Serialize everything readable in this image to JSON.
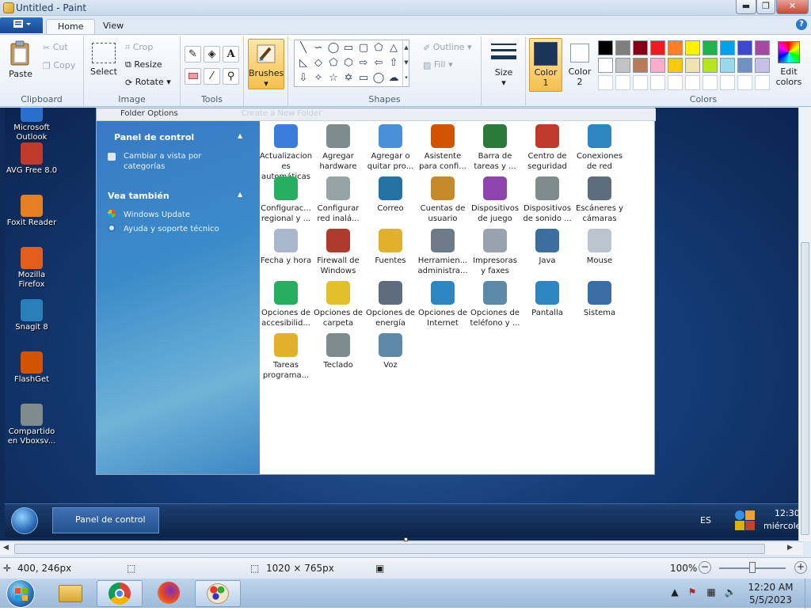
{
  "window": {
    "title": "Untitled - Paint"
  },
  "controls": {
    "minimize": "▬",
    "maximize": "❐",
    "close": "✕"
  },
  "tabs": {
    "home": "Home",
    "view": "View",
    "help": "?"
  },
  "ribbon": {
    "clipboard": {
      "label": "Clipboard",
      "paste": "Paste",
      "cut": "Cut",
      "copy": "Copy"
    },
    "image": {
      "label": "Image",
      "select": "Select",
      "crop": "Crop",
      "resize": "Resize",
      "rotate": "Rotate"
    },
    "tools": {
      "label": "Tools",
      "text_tool": "A"
    },
    "brushes": "Brushes",
    "shapes": {
      "label": "Shapes",
      "outline": "Outline",
      "fill": "Fill"
    },
    "size": "Size",
    "color1": {
      "l1": "Color",
      "l2": "1",
      "value": "#1b3559"
    },
    "color2": {
      "l1": "Color",
      "l2": "2",
      "value": "#ffffff"
    },
    "colors": {
      "label": "Colors",
      "edit_l1": "Edit",
      "edit_l2": "colors",
      "row1": [
        "#000000",
        "#7f7f7f",
        "#880015",
        "#ed1c24",
        "#ff7f27",
        "#fff200",
        "#22b14c",
        "#00a2e8",
        "#3f48cc",
        "#a349a4"
      ],
      "row2": [
        "#ffffff",
        "#c3c3c3",
        "#b97a57",
        "#ffaec9",
        "#ffc90e",
        "#efe4b0",
        "#b5e61d",
        "#99d9ea",
        "#7092be",
        "#c8bfe7"
      ]
    }
  },
  "desktop": {
    "icons": [
      {
        "l1": "Microsoft",
        "l2": "Outlook"
      },
      {
        "l1": "AVG Free 8.0",
        "l2": ""
      },
      {
        "l1": "Foxit Reader",
        "l2": ""
      },
      {
        "l1": "Mozilla",
        "l2": "Firefox"
      },
      {
        "l1": "Snagit 8",
        "l2": ""
      },
      {
        "l1": "FlashGet",
        "l2": ""
      },
      {
        "l1": "Compartido",
        "l2": "en Vboxsv..."
      }
    ],
    "window": {
      "topbar": "Folder Options",
      "topbar_ghost": "Create a New Folder",
      "side": {
        "h1": "Panel de control",
        "link1a": "Cambiar a vista por",
        "link1b": "categorías",
        "h2": "Vea también",
        "link2": "Windows Update",
        "link3": "Ayuda y soporte técnico"
      },
      "items": [
        {
          "l1": "Actualizacion",
          "l2": "es",
          "l3": "automáticas"
        },
        {
          "l1": "Agregar",
          "l2": "hardware",
          "l3": ""
        },
        {
          "l1": "Agregar o",
          "l2": "quitar pro...",
          "l3": ""
        },
        {
          "l1": "Asistente",
          "l2": "para confi...",
          "l3": ""
        },
        {
          "l1": "Barra de",
          "l2": "tareas y ...",
          "l3": ""
        },
        {
          "l1": "Centro de",
          "l2": "seguridad",
          "l3": ""
        },
        {
          "l1": "Conexiones",
          "l2": "de red",
          "l3": ""
        },
        {
          "l1": "Configurac...",
          "l2": "regional y ...",
          "l3": ""
        },
        {
          "l1": "Configurar",
          "l2": "red inalá...",
          "l3": ""
        },
        {
          "l1": "Correo",
          "l2": "",
          "l3": ""
        },
        {
          "l1": "Cuentas de",
          "l2": "usuario",
          "l3": ""
        },
        {
          "l1": "Dispositivos",
          "l2": "de juego",
          "l3": ""
        },
        {
          "l1": "Dispositivos",
          "l2": "de sonido ...",
          "l3": ""
        },
        {
          "l1": "Escáneres y",
          "l2": "cámaras",
          "l3": ""
        },
        {
          "l1": "Fecha y hora",
          "l2": "",
          "l3": ""
        },
        {
          "l1": "Firewall de",
          "l2": "Windows",
          "l3": ""
        },
        {
          "l1": "Fuentes",
          "l2": "",
          "l3": ""
        },
        {
          "l1": "Herramien...",
          "l2": "administra...",
          "l3": ""
        },
        {
          "l1": "Impresoras",
          "l2": "y faxes",
          "l3": ""
        },
        {
          "l1": "Java",
          "l2": "",
          "l3": ""
        },
        {
          "l1": "Mouse",
          "l2": "",
          "l3": ""
        },
        {
          "l1": "Opciones de",
          "l2": "accesibilid...",
          "l3": ""
        },
        {
          "l1": "Opciones de",
          "l2": "carpeta",
          "l3": ""
        },
        {
          "l1": "Opciones de",
          "l2": "energía",
          "l3": ""
        },
        {
          "l1": "Opciones de",
          "l2": "Internet",
          "l3": ""
        },
        {
          "l1": "Opciones de",
          "l2": "teléfono y ...",
          "l3": ""
        },
        {
          "l1": "Pantalla",
          "l2": "",
          "l3": ""
        },
        {
          "l1": "Sistema",
          "l2": "",
          "l3": ""
        },
        {
          "l1": "Tareas",
          "l2": "programa...",
          "l3": ""
        },
        {
          "l1": "Teclado",
          "l2": "",
          "l3": ""
        },
        {
          "l1": "Voz",
          "l2": "",
          "l3": ""
        }
      ]
    },
    "taskbar": {
      "button": "Panel de control",
      "lang": "ES",
      "time": "12:30",
      "day": "miércole"
    }
  },
  "status": {
    "cursor": "400, 246px",
    "size": "1020 × 765px",
    "zoom": "100%",
    "zoom_out": "−",
    "zoom_in": "+"
  },
  "win_taskbar": {
    "time": "12:20 AM",
    "date": "5/5/2023"
  }
}
